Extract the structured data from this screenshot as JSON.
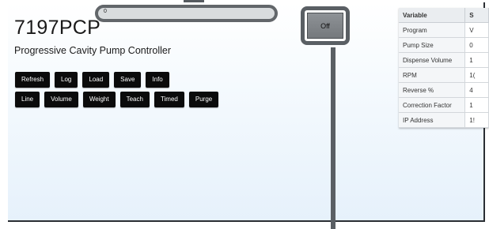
{
  "header": {
    "device_name": "7197PCP",
    "subtitle": "Progressive Cavity Pump Controller"
  },
  "progress": {
    "value": 0,
    "text": "0"
  },
  "buttons_row1": [
    "Refresh",
    "Log",
    "Load",
    "Save",
    "Info"
  ],
  "buttons_row2": [
    "Line",
    "Volume",
    "Weight",
    "Teach",
    "Timed",
    "Purge"
  ],
  "power_button": {
    "label": "Off"
  },
  "variables_table": {
    "headers": [
      "Variable",
      "S"
    ],
    "rows": [
      [
        "Program",
        "V"
      ],
      [
        "Pump Size",
        "0"
      ],
      [
        "Dispense Volume",
        "1"
      ],
      [
        "RPM",
        "1("
      ],
      [
        "Reverse %",
        "4"
      ],
      [
        "Correction Factor",
        "1"
      ],
      [
        "IP Address",
        "1!"
      ]
    ]
  },
  "colors": {
    "button_bg": "#0b0b0b",
    "button_text": "#ffffff",
    "annotation_ring": "#5a5f64",
    "panel_gradient_bottom": "#e6f1fb"
  }
}
